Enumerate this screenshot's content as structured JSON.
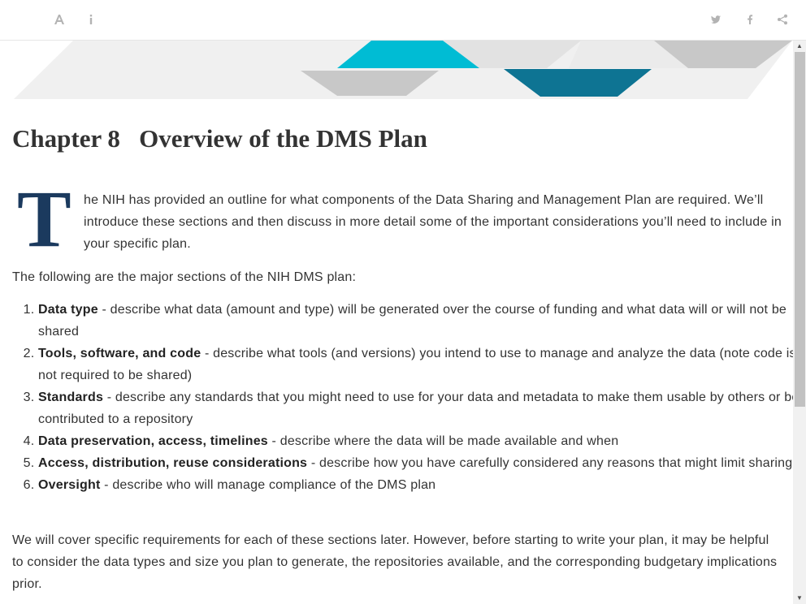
{
  "toolbar": {
    "left_icons": [
      "font-settings-icon",
      "info-icon"
    ],
    "right_icons": [
      "twitter-icon",
      "facebook-icon",
      "share-icon"
    ]
  },
  "chapter": {
    "title": "Chapter 8   Overview of the DMS Plan"
  },
  "intro": {
    "dropcap": "T",
    "text": "he NIH has provided an outline for what components of the Data Sharing and Management Plan are required. We’ll introduce these sections and then discuss in more detail some of the important considerations you’ll need to include in your specific plan."
  },
  "lead": "The following are the major sections of the NIH DMS plan:",
  "sections": [
    {
      "term": "Data type",
      "desc": " - describe what data (amount and type) will be generated over the course of funding and what data will or will not be shared"
    },
    {
      "term": "Tools, software, and code",
      "desc": " - describe what tools (and versions) you intend to use to manage and analyze the data (note code is not required to be shared)"
    },
    {
      "term": "Standards",
      "desc": " - describe any standards that you might need to use for your data and metadata to make them usable by others or be contributed to a repository"
    },
    {
      "term": "Data preservation, access, timelines",
      "desc": " - describe where the data will be made available and when"
    },
    {
      "term": "Access, distribution, reuse considerations",
      "desc": " - describe how you have carefully considered any reasons that might limit sharing"
    },
    {
      "term": "Oversight",
      "desc": " - describe who will manage compliance of the DMS plan"
    }
  ],
  "outro": "We will cover specific requirements for each of these sections later. However, before starting to write your plan, it may be helpful to consider the data types and size you plan to generate, the repositories available, and the corresponding budgetary implications prior.",
  "colors": {
    "dropcap": "#1b3a5e",
    "banner_teal": "#00bcd4",
    "banner_dark_teal": "#0e7493",
    "banner_gray": "#c8c8c8",
    "banner_light_gray": "#e8e8e8"
  }
}
